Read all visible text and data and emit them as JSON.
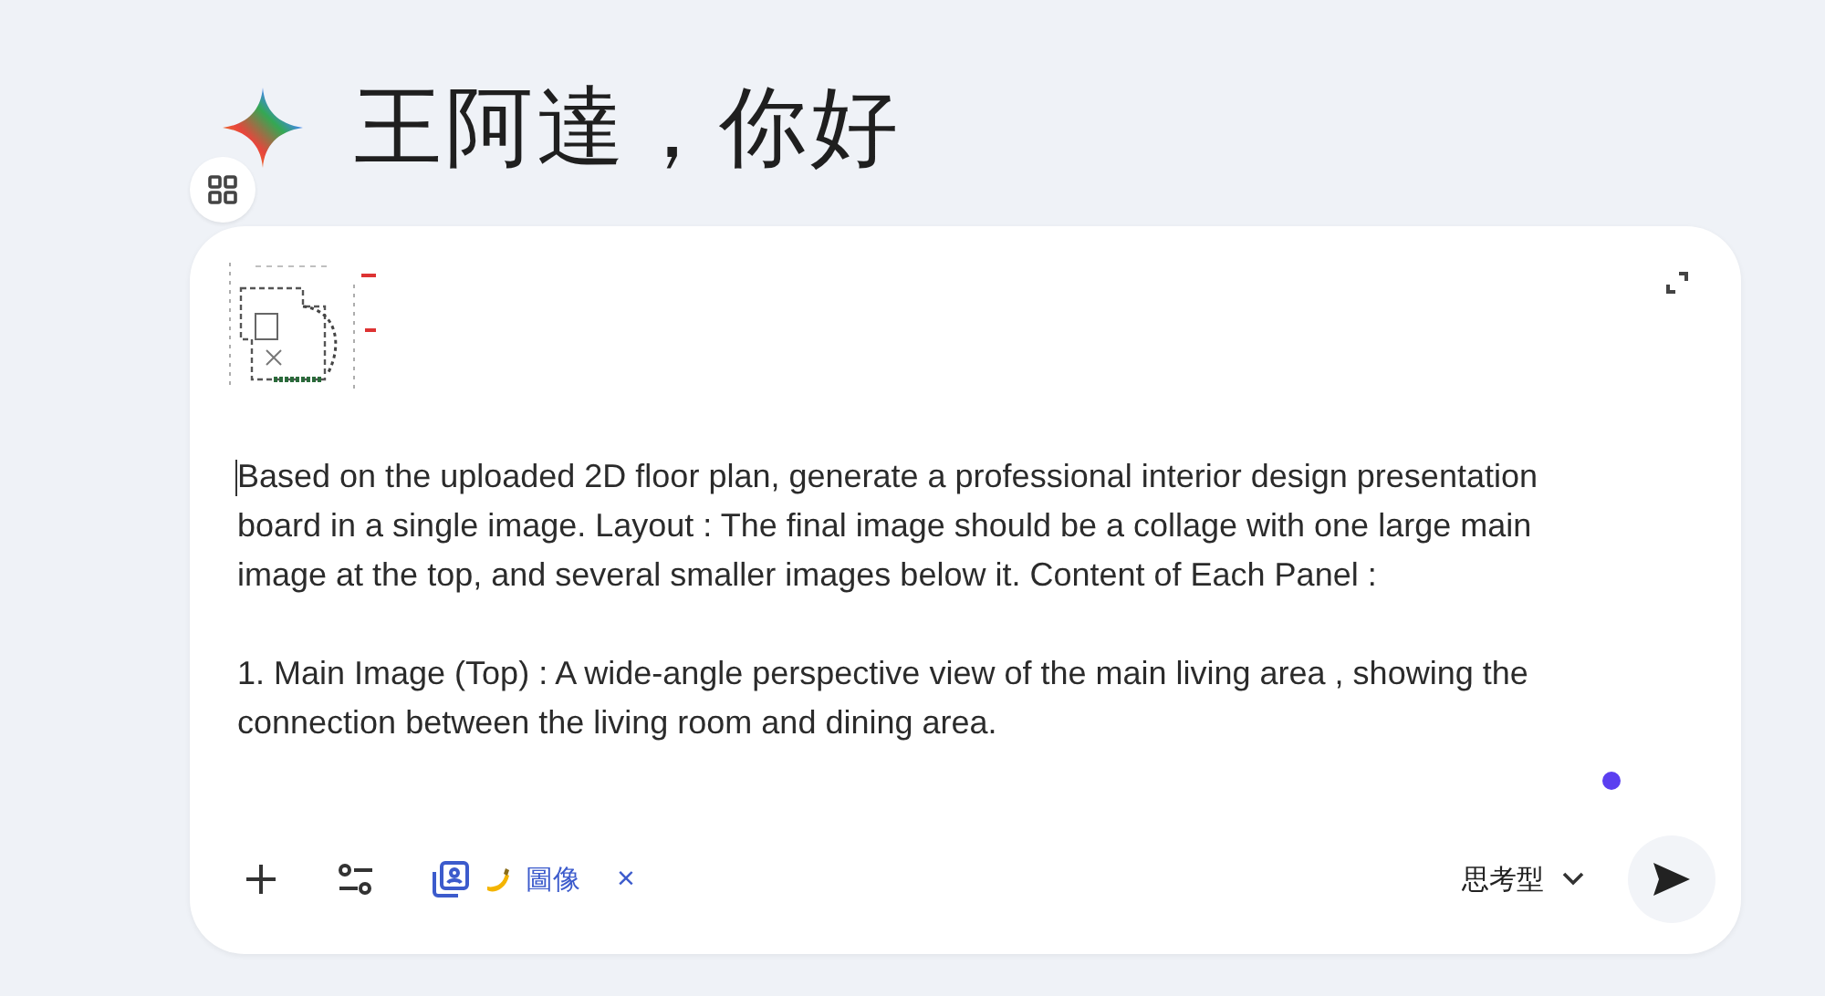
{
  "greeting": "王阿達，你好",
  "prompt": {
    "paragraphs": [
      "Based on the uploaded 2D floor plan, generate a professional interior design presentation board in a single image. Layout : The final image should be a collage with one large main image at the top, and several smaller images below it. Content of Each Panel :",
      "1. Main Image (Top) : A wide-angle perspective view of the main living area , showing the connection between the living room and dining area."
    ]
  },
  "toolbar": {
    "tool_chip": {
      "label": "圖像",
      "close": "×"
    },
    "model": {
      "label": "思考型"
    }
  }
}
